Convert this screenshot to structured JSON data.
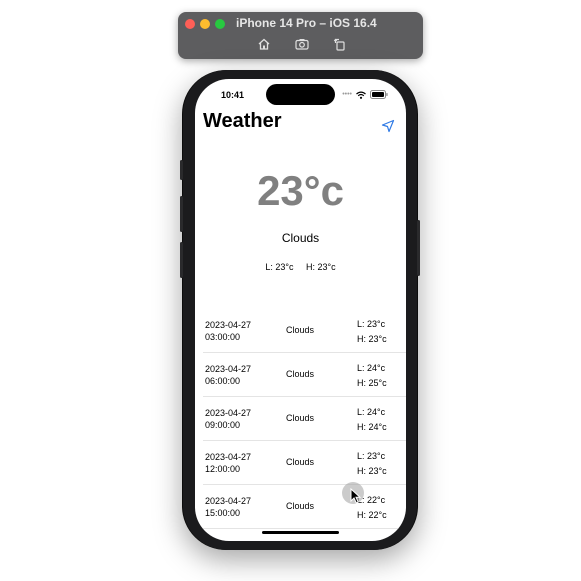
{
  "simulator": {
    "title": "iPhone 14 Pro – iOS 16.4",
    "tools": [
      "home-icon",
      "screenshot-icon",
      "rotate-icon"
    ]
  },
  "status_bar": {
    "time": "10:41",
    "dots": "••••"
  },
  "app": {
    "title": "Weather",
    "location_icon": "location-arrow-icon",
    "accent": "#2f7ae5"
  },
  "current": {
    "temperature": "23°c",
    "condition": "Clouds",
    "low": "L: 23°c",
    "high": "H: 23°c"
  },
  "forecast": [
    {
      "date": "2023-04-27",
      "time": "03:00:00",
      "condition": "Clouds",
      "low": "L: 23°c",
      "high": "H: 23°c"
    },
    {
      "date": "2023-04-27",
      "time": "06:00:00",
      "condition": "Clouds",
      "low": "L: 24°c",
      "high": "H: 25°c"
    },
    {
      "date": "2023-04-27",
      "time": "09:00:00",
      "condition": "Clouds",
      "low": "L: 24°c",
      "high": "H: 24°c"
    },
    {
      "date": "2023-04-27",
      "time": "12:00:00",
      "condition": "Clouds",
      "low": "L: 23°c",
      "high": "H: 23°c"
    },
    {
      "date": "2023-04-27",
      "time": "15:00:00",
      "condition": "Clouds",
      "low": "L: 22°c",
      "high": "H: 22°c"
    }
  ]
}
